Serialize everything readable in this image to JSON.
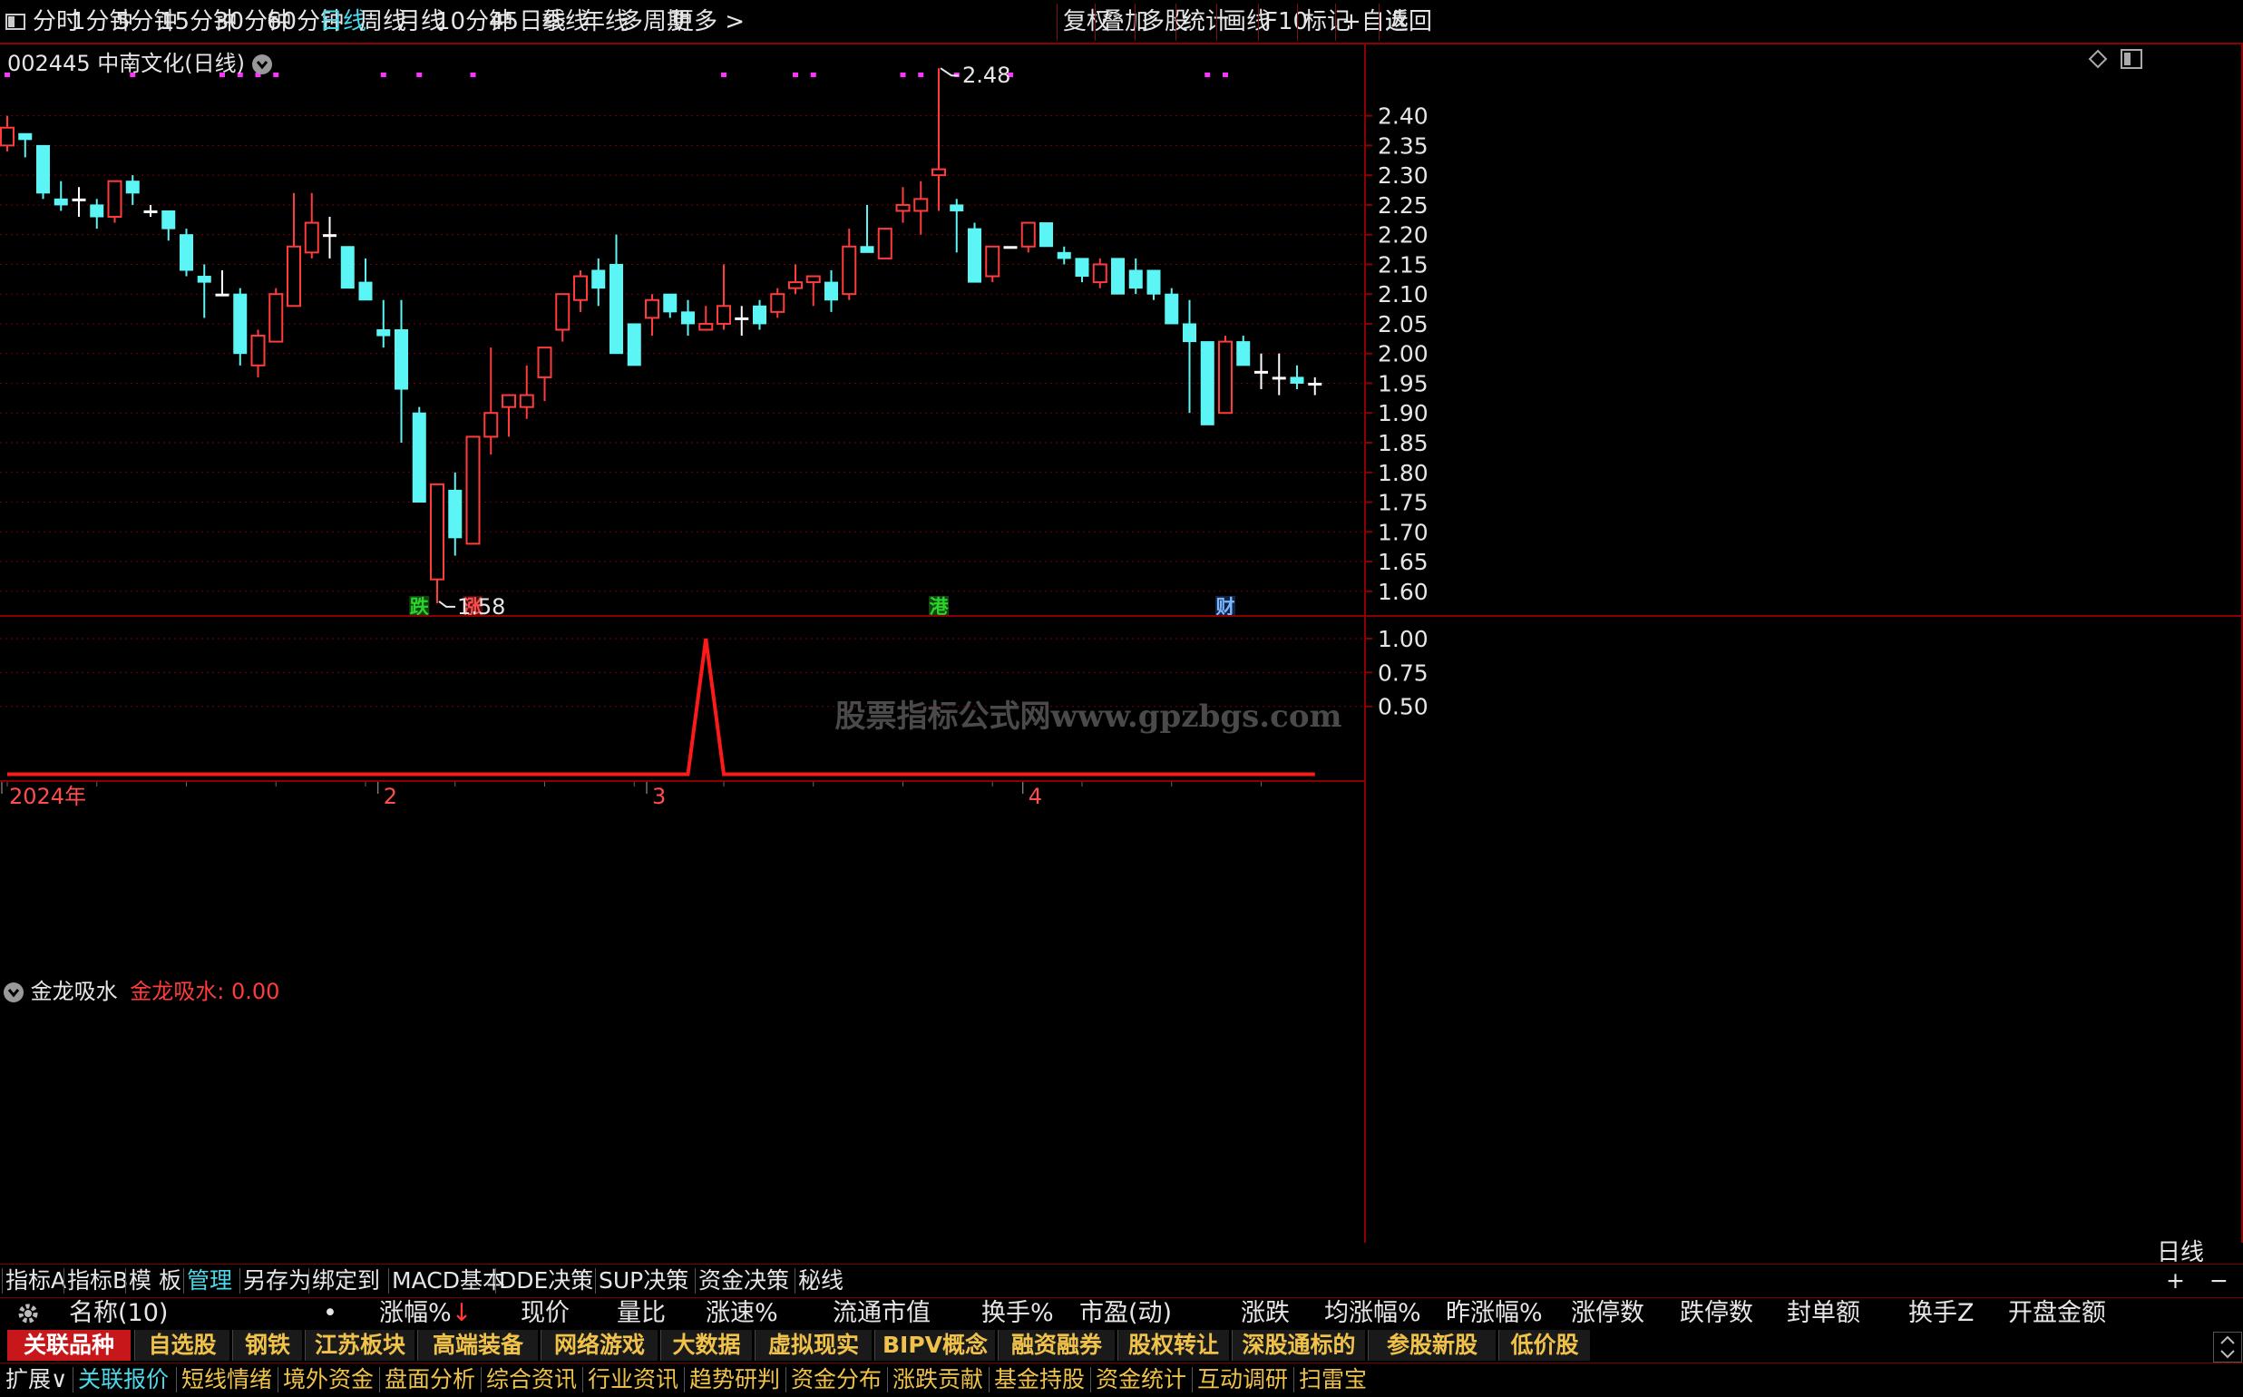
{
  "topbar": {
    "periods": [
      "分时",
      "1分钟",
      "5分钟",
      "15分钟",
      "30分钟",
      "60分钟",
      "日线",
      "周线",
      "月线",
      "10分钟",
      "45日线",
      "季线",
      "年线",
      "多周期",
      "更多 >"
    ],
    "active_period": "日线",
    "right_buttons": [
      "复权",
      "叠加",
      "多股",
      "统计",
      "画线",
      "F10",
      "标记",
      "+自选",
      "返回"
    ]
  },
  "stock": {
    "code": "002445",
    "name": "中南文化",
    "period_label": "(日线)",
    "title": "002445 中南文化(日线)"
  },
  "watermark": "股票指标公式网www.gpzbgs.com",
  "colors": {
    "up": "#ff3b3b",
    "down": "#5cf5f5",
    "grid": "#7a0000",
    "indicator_line": "#ff1a1a",
    "flat": "#ffffff"
  },
  "annotations": {
    "high_label": "2.48",
    "low_label": "1.58",
    "markers": [
      {
        "text": "跌",
        "color": "#2bd42b",
        "bg": "#114411",
        "candle": 23
      },
      {
        "text": "涨",
        "color": "#ff4d4d",
        "bg": "#441111",
        "candle": 26
      },
      {
        "text": "港",
        "color": "#2bd42b",
        "bg": "#114411",
        "candle": 52
      },
      {
        "text": "财",
        "color": "#7ab8ff",
        "bg": "#112244",
        "candle": 68
      }
    ],
    "magenta_dot_candles": [
      0,
      7,
      12,
      13,
      14,
      15,
      21,
      23,
      26,
      40,
      44,
      45,
      50,
      51,
      53,
      56,
      67,
      68
    ]
  },
  "indicator": {
    "name": "金龙吸水",
    "value_label": "金龙吸水: 0.00",
    "peak_index": 39
  },
  "chart_data": [
    {
      "type": "candlestick",
      "title": "002445 中南文化(日线)",
      "ylim": [
        1.56,
        2.52
      ],
      "yticks": [
        1.6,
        1.65,
        1.7,
        1.75,
        1.8,
        1.85,
        1.9,
        1.95,
        2.0,
        2.05,
        2.1,
        2.15,
        2.2,
        2.25,
        2.3,
        2.35,
        2.4
      ],
      "x_labels": [
        {
          "text": "2024年",
          "index": 0
        },
        {
          "text": "2",
          "index": 21
        },
        {
          "text": "3",
          "index": 36
        },
        {
          "text": "4",
          "index": 57
        }
      ],
      "grid": "dotted horizontal",
      "ohlc": [
        [
          2.35,
          2.4,
          2.34,
          2.38
        ],
        [
          2.37,
          2.37,
          2.33,
          2.36
        ],
        [
          2.35,
          2.35,
          2.26,
          2.27
        ],
        [
          2.26,
          2.29,
          2.24,
          2.25
        ],
        [
          2.26,
          2.28,
          2.23,
          2.26
        ],
        [
          2.25,
          2.26,
          2.21,
          2.23
        ],
        [
          2.23,
          2.29,
          2.22,
          2.29
        ],
        [
          2.29,
          2.3,
          2.25,
          2.27
        ],
        [
          2.24,
          2.25,
          2.23,
          2.24
        ],
        [
          2.24,
          2.24,
          2.19,
          2.21
        ],
        [
          2.2,
          2.21,
          2.13,
          2.14
        ],
        [
          2.13,
          2.15,
          2.06,
          2.12
        ],
        [
          2.1,
          2.14,
          2.1,
          2.1
        ],
        [
          2.1,
          2.11,
          1.98,
          2.0
        ],
        [
          1.98,
          2.04,
          1.96,
          2.03
        ],
        [
          2.02,
          2.11,
          2.02,
          2.1
        ],
        [
          2.08,
          2.27,
          2.08,
          2.18
        ],
        [
          2.17,
          2.27,
          2.16,
          2.22
        ],
        [
          2.2,
          2.23,
          2.16,
          2.2
        ],
        [
          2.18,
          2.18,
          2.11,
          2.11
        ],
        [
          2.12,
          2.16,
          2.1,
          2.09
        ],
        [
          2.04,
          2.09,
          2.01,
          2.03
        ],
        [
          2.04,
          2.09,
          1.85,
          1.94
        ],
        [
          1.9,
          1.91,
          1.75,
          1.75
        ],
        [
          1.62,
          1.75,
          1.58,
          1.78
        ],
        [
          1.77,
          1.8,
          1.66,
          1.69
        ],
        [
          1.68,
          1.86,
          1.68,
          1.86
        ],
        [
          1.86,
          2.01,
          1.83,
          1.9
        ],
        [
          1.91,
          1.92,
          1.86,
          1.93
        ],
        [
          1.91,
          1.98,
          1.89,
          1.93
        ],
        [
          1.96,
          2.0,
          1.92,
          2.01
        ],
        [
          2.04,
          2.1,
          2.02,
          2.1
        ],
        [
          2.09,
          2.14,
          2.07,
          2.13
        ],
        [
          2.14,
          2.16,
          2.08,
          2.11
        ],
        [
          2.15,
          2.2,
          2.0,
          2.0
        ],
        [
          2.05,
          2.05,
          1.98,
          1.98
        ],
        [
          2.06,
          2.1,
          2.03,
          2.09
        ],
        [
          2.1,
          2.1,
          2.06,
          2.07
        ],
        [
          2.07,
          2.09,
          2.03,
          2.05
        ],
        [
          2.04,
          2.08,
          2.04,
          2.05
        ],
        [
          2.05,
          2.15,
          2.04,
          2.08
        ],
        [
          2.06,
          2.08,
          2.03,
          2.06
        ],
        [
          2.08,
          2.09,
          2.04,
          2.05
        ],
        [
          2.07,
          2.11,
          2.06,
          2.1
        ],
        [
          2.11,
          2.15,
          2.1,
          2.12
        ],
        [
          2.12,
          2.13,
          2.08,
          2.13
        ],
        [
          2.12,
          2.14,
          2.07,
          2.09
        ],
        [
          2.1,
          2.21,
          2.09,
          2.18
        ],
        [
          2.18,
          2.25,
          2.17,
          2.17
        ],
        [
          2.16,
          2.21,
          2.16,
          2.21
        ],
        [
          2.24,
          2.28,
          2.22,
          2.25
        ],
        [
          2.24,
          2.29,
          2.2,
          2.26
        ],
        [
          2.3,
          2.48,
          2.24,
          2.31
        ],
        [
          2.25,
          2.26,
          2.17,
          2.24
        ],
        [
          2.21,
          2.22,
          2.12,
          2.12
        ],
        [
          2.13,
          2.18,
          2.12,
          2.18
        ],
        [
          2.18,
          2.18,
          2.18,
          2.18
        ],
        [
          2.18,
          2.22,
          2.17,
          2.22
        ],
        [
          2.22,
          2.22,
          2.18,
          2.18
        ],
        [
          2.17,
          2.18,
          2.15,
          2.16
        ],
        [
          2.16,
          2.16,
          2.12,
          2.13
        ],
        [
          2.12,
          2.16,
          2.11,
          2.15
        ],
        [
          2.16,
          2.16,
          2.1,
          2.1
        ],
        [
          2.14,
          2.16,
          2.1,
          2.11
        ],
        [
          2.14,
          2.14,
          2.09,
          2.1
        ],
        [
          2.1,
          2.11,
          2.05,
          2.05
        ],
        [
          2.05,
          2.09,
          1.9,
          2.02
        ],
        [
          2.02,
          2.02,
          1.88,
          1.88
        ],
        [
          1.9,
          2.03,
          1.9,
          2.02
        ],
        [
          2.02,
          2.03,
          1.98,
          1.98
        ],
        [
          1.97,
          2.0,
          1.94,
          1.97
        ],
        [
          1.96,
          2.0,
          1.93,
          1.96
        ],
        [
          1.96,
          1.98,
          1.94,
          1.95
        ],
        [
          1.95,
          1.96,
          1.93,
          1.95
        ]
      ]
    },
    {
      "type": "line",
      "title": "金龙吸水",
      "series": [
        {
          "name": "金龙吸水",
          "values": [
            0,
            0,
            0,
            0,
            0,
            0,
            0,
            0,
            0,
            0,
            0,
            0,
            0,
            0,
            0,
            0,
            0,
            0,
            0,
            0,
            0,
            0,
            0,
            0,
            0,
            0,
            0,
            0,
            0,
            0,
            0,
            0,
            0,
            0,
            0,
            0,
            0,
            0,
            0,
            1,
            0,
            0,
            0,
            0,
            0,
            0,
            0,
            0,
            0,
            0,
            0,
            0,
            0,
            0,
            0,
            0,
            0,
            0,
            0,
            0,
            0,
            0,
            0,
            0,
            0,
            0,
            0,
            0,
            0,
            0,
            0,
            0,
            0,
            0
          ]
        }
      ],
      "ylim": [
        -0.05,
        1.1
      ],
      "yticks": [
        0.5,
        0.75,
        1.0
      ]
    }
  ],
  "right_axis_label": "日线",
  "tabs1": {
    "items": [
      "指标A",
      "指标B",
      "模 板",
      "管理",
      "另存为",
      "绑定到",
      "MACD基本",
      "DDE决策",
      "SUP决策",
      "资金决策",
      "秘线"
    ],
    "active": "管理",
    "plus": "+",
    "minus": "−"
  },
  "quote_header": {
    "columns": [
      "名称(10)",
      "•",
      "涨幅%↓",
      "现价",
      "量比",
      "涨速%",
      "流通市值",
      "换手%",
      "市盈(动)",
      "涨跌",
      "均涨幅%",
      "昨涨幅%",
      "涨停数",
      "跌停数",
      "封单额",
      "换手Z",
      "开盘金额"
    ]
  },
  "sector_tabs": {
    "items": [
      "关联品种",
      "自选股",
      "钢铁",
      "江苏板块",
      "高端装备",
      "网络游戏",
      "大数据",
      "虚拟现实",
      "BIPV概念",
      "融资融券",
      "股权转让",
      "深股通标的",
      "参股新股",
      "低价股"
    ],
    "active": "关联品种"
  },
  "bottom_links": {
    "expand": "扩展∨",
    "items": [
      "关联报价",
      "短线情绪",
      "境外资金",
      "盘面分析",
      "综合资讯",
      "行业资讯",
      "趋势研判",
      "资金分布",
      "涨跌贡献",
      "基金持股",
      "资金统计",
      "互动调研",
      "扫雷宝"
    ],
    "active": "关联报价"
  }
}
